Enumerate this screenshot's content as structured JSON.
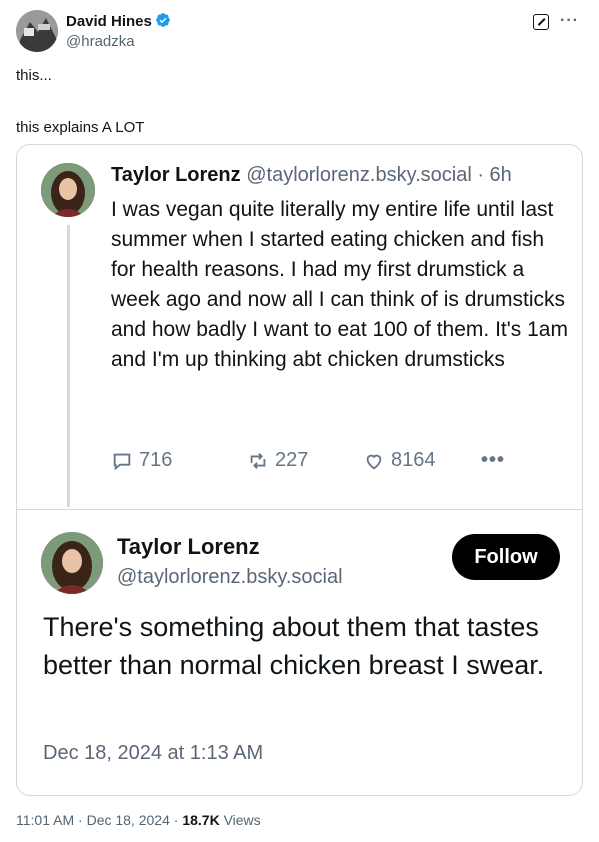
{
  "tweet": {
    "author_name": "David Hines",
    "author_handle": "@hradzka",
    "text_line1": "this...",
    "text_line2": "this explains A LOT",
    "time": "11:01 AM",
    "date": "Dec 18, 2024",
    "views_count": "18.7K",
    "views_label": "Views"
  },
  "quoted_post_1": {
    "name": "Taylor Lorenz",
    "handle_time": "@taylorlorenz.bsky.social · 6h",
    "body": "I was vegan quite literally my entire life until last summer when I started eating chicken and fish for health reasons. I had my first drumstick a week ago and now all I can think of is drumsticks and how badly I want to eat 100 of them. It's 1am and I'm up thinking abt chicken drumsticks",
    "replies": "716",
    "reposts": "227",
    "likes": "8164"
  },
  "quoted_post_2": {
    "name": "Taylor Lorenz",
    "handle": "@taylorlorenz.bsky.social",
    "follow_label": "Follow",
    "body": "There's something about them that tastes better than normal chicken breast I swear.",
    "timestamp": "Dec 18, 2024 at 1:13 AM"
  },
  "colors": {
    "verified": "#1d9bf0",
    "follow_bg": "#000000"
  }
}
